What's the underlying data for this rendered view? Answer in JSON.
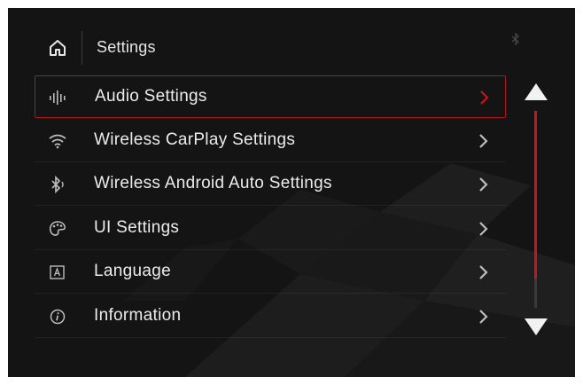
{
  "header": {
    "title": "Settings",
    "home_icon": "home-icon",
    "status_icon": "bluetooth-icon"
  },
  "menu": {
    "selected_index": 0,
    "items": [
      {
        "label": "Audio Settings",
        "icon": "audio-bars-icon"
      },
      {
        "label": "Wireless CarPlay Settings",
        "icon": "wifi-icon"
      },
      {
        "label": "Wireless Android Auto Settings",
        "icon": "bluetooth-icon"
      },
      {
        "label": "UI Settings",
        "icon": "palette-icon"
      },
      {
        "label": "Language",
        "icon": "language-icon"
      },
      {
        "label": "Information",
        "icon": "info-icon"
      }
    ]
  },
  "scrollbar": {
    "thumb_fraction": 0.85
  },
  "colors": {
    "accent": "#c8151b",
    "background": "#141414",
    "text": "#ececec"
  }
}
